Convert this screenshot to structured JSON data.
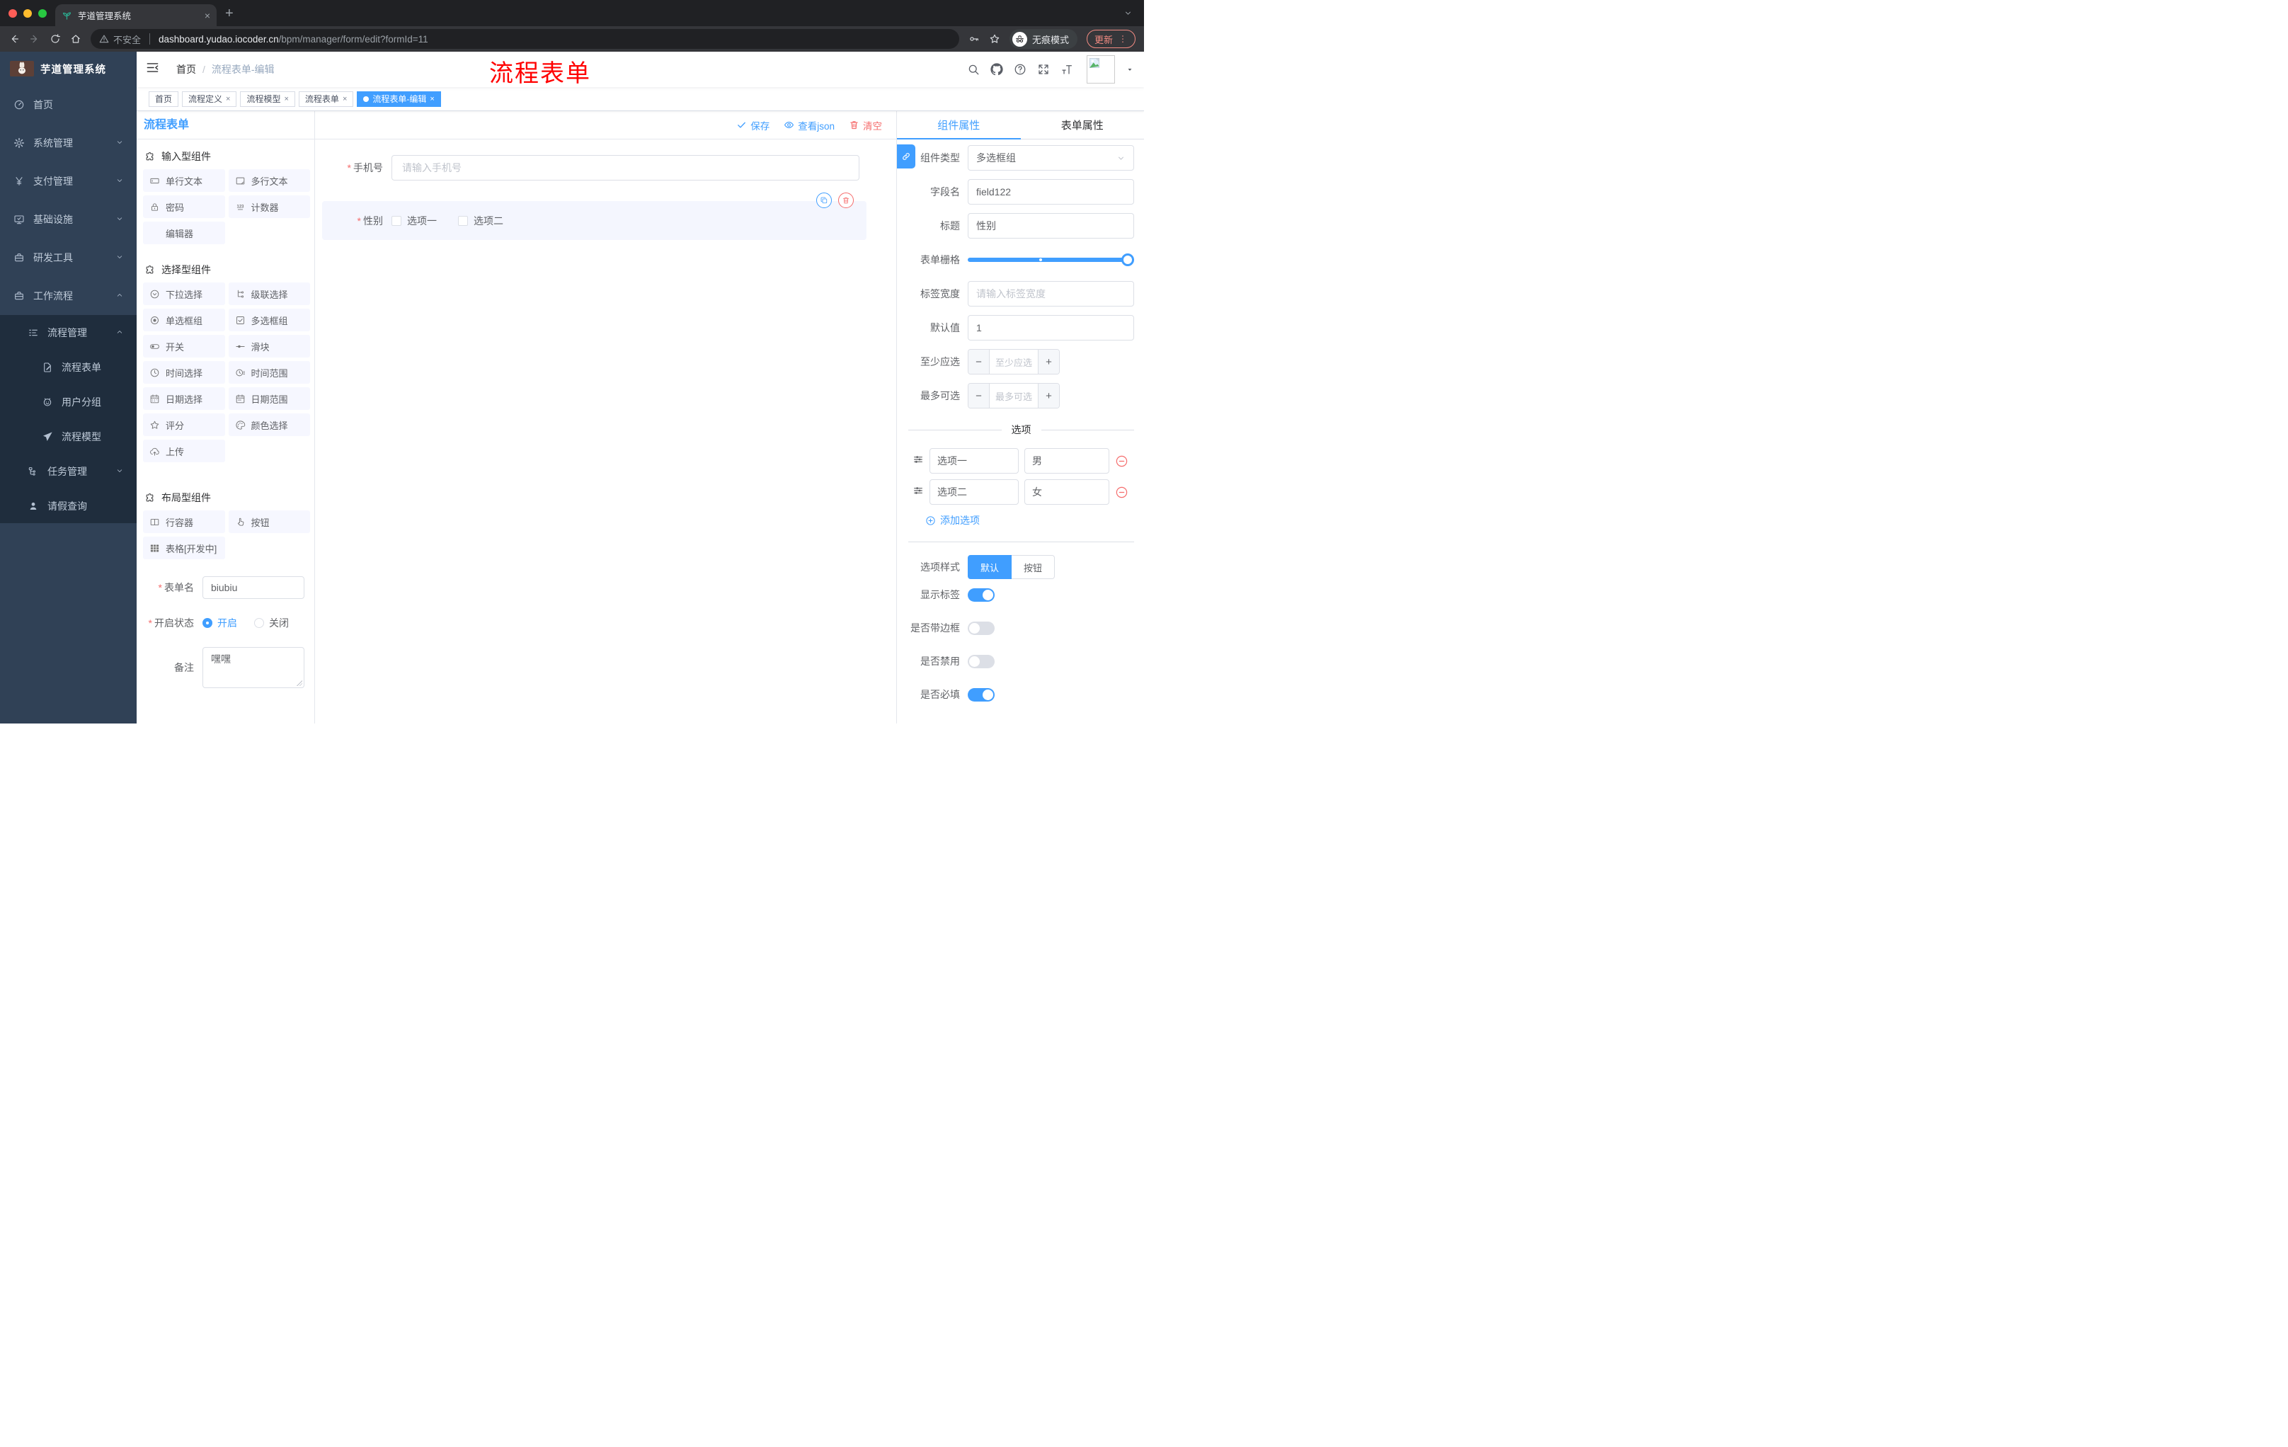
{
  "required_mark": "*",
  "browser": {
    "tab_title": "芋道管理系统",
    "new_tab": "+",
    "tab_close": "×",
    "security_chip": "不安全",
    "url_host": "dashboard.yudao.iocoder.cn",
    "url_path": "/bpm/manager/form/edit?formId=11",
    "incognito_label": "无痕模式",
    "update_button": "更新"
  },
  "sidebar": {
    "logo_title": "芋道管理系统",
    "items": [
      {
        "label": "首页",
        "icon": "dashboard",
        "level": 1
      },
      {
        "label": "系统管理",
        "icon": "gear",
        "level": 1,
        "arrow": "down"
      },
      {
        "label": "支付管理",
        "icon": "yen",
        "level": 1,
        "arrow": "down"
      },
      {
        "label": "基础设施",
        "icon": "monitor",
        "level": 1,
        "arrow": "down"
      },
      {
        "label": "研发工具",
        "icon": "briefcase",
        "level": 1,
        "arrow": "down"
      },
      {
        "label": "工作流程",
        "icon": "briefcase",
        "level": 1,
        "arrow": "up"
      },
      {
        "label": "流程管理",
        "icon": "list-tree",
        "level": 2,
        "arrow": "up"
      },
      {
        "label": "流程表单",
        "icon": "doc-edit",
        "level": 3
      },
      {
        "label": "用户分组",
        "icon": "robot",
        "level": 3
      },
      {
        "label": "流程模型",
        "icon": "paper-plane",
        "level": 3
      },
      {
        "label": "任务管理",
        "icon": "org",
        "level": 2,
        "arrow": "down"
      },
      {
        "label": "请假查询",
        "icon": "person",
        "level": 2
      }
    ]
  },
  "navbar": {
    "breadcrumb_home": "首页",
    "breadcrumb_sep": "/",
    "breadcrumb_current": "流程表单-编辑",
    "annotation": "流程表单"
  },
  "tags": [
    {
      "label": "首页",
      "closable": false,
      "active": false
    },
    {
      "label": "流程定义",
      "closable": true,
      "active": false
    },
    {
      "label": "流程模型",
      "closable": true,
      "active": false
    },
    {
      "label": "流程表单",
      "closable": true,
      "active": false
    },
    {
      "label": "流程表单-编辑",
      "closable": true,
      "active": true
    }
  ],
  "palette": {
    "title": "流程表单",
    "sections": [
      {
        "title": "输入型组件",
        "items": [
          {
            "label": "单行文本",
            "icon": "input"
          },
          {
            "label": "多行文本",
            "icon": "textarea"
          },
          {
            "label": "密码",
            "icon": "lock"
          },
          {
            "label": "计数器",
            "icon": "counter"
          },
          {
            "label": "编辑器",
            "icon": null
          }
        ]
      },
      {
        "title": "选择型组件",
        "items": [
          {
            "label": "下拉选择",
            "icon": "select"
          },
          {
            "label": "级联选择",
            "icon": "cascade"
          },
          {
            "label": "单选框组",
            "icon": "radio"
          },
          {
            "label": "多选框组",
            "icon": "checkbox"
          },
          {
            "label": "开关",
            "icon": "switch"
          },
          {
            "label": "滑块",
            "icon": "slider"
          },
          {
            "label": "时间选择",
            "icon": "clock"
          },
          {
            "label": "时间范围",
            "icon": "time-range"
          },
          {
            "label": "日期选择",
            "icon": "calendar"
          },
          {
            "label": "日期范围",
            "icon": "calendar-range"
          },
          {
            "label": "评分",
            "icon": "star"
          },
          {
            "label": "颜色选择",
            "icon": "palette"
          },
          {
            "label": "上传",
            "icon": "upload"
          }
        ]
      },
      {
        "title": "布局型组件",
        "items": [
          {
            "label": "行容器",
            "icon": "columns"
          },
          {
            "label": "按钮",
            "icon": "pointer"
          },
          {
            "label": "表格[开发中]",
            "icon": "table"
          }
        ]
      }
    ],
    "form": {
      "name_label": "表单名",
      "name_value": "biubiu",
      "status_label": "开启状态",
      "status_options": [
        {
          "label": "开启",
          "selected": true
        },
        {
          "label": "关闭",
          "selected": false
        }
      ],
      "remark_label": "备注",
      "remark_value": "嘿嘿"
    }
  },
  "canvas": {
    "actions": [
      {
        "label": "保存",
        "icon": "check",
        "color": "#409eff"
      },
      {
        "label": "查看json",
        "icon": "eye",
        "color": "#409eff"
      },
      {
        "label": "清空",
        "icon": "trash",
        "color": "#f56c6c"
      }
    ],
    "phone_field": {
      "label": "手机号",
      "placeholder": "请输入手机号"
    },
    "gender_field": {
      "label": "性别",
      "options": [
        "选项一",
        "选项二"
      ]
    }
  },
  "panel": {
    "tabs": [
      {
        "label": "组件属性",
        "active": true
      },
      {
        "label": "表单属性",
        "active": false
      }
    ],
    "rows": {
      "type_label": "组件类型",
      "type_value": "多选框组",
      "field_label": "字段名",
      "field_value": "field122",
      "title_label": "标题",
      "title_value": "性别",
      "grid_label": "表单栅格",
      "labelwidth_label": "标签宽度",
      "labelwidth_placeholder": "请输入标签宽度",
      "default_label": "默认值",
      "default_value": "1",
      "min_label": "至少应选",
      "min_placeholder": "至少应选",
      "max_label": "最多可选",
      "max_placeholder": "最多可选",
      "stepper_minus": "−",
      "stepper_plus": "+"
    },
    "options_divider": "选项",
    "options": [
      {
        "name": "选项一",
        "value": "男"
      },
      {
        "name": "选项二",
        "value": "女"
      }
    ],
    "add_option": "添加选项",
    "style_label": "选项样式",
    "style_options": [
      {
        "label": "默认",
        "active": true
      },
      {
        "label": "按钮",
        "active": false
      }
    ],
    "switches": [
      {
        "label": "显示标签",
        "on": true
      },
      {
        "label": "是否带边框",
        "on": false
      },
      {
        "label": "是否禁用",
        "on": false
      },
      {
        "label": "是否必填",
        "on": true
      }
    ]
  },
  "colors": {
    "accent": "#409eff",
    "danger": "#f56c6c",
    "annotation": "#ff0000",
    "sidebar_bg": "#304156",
    "submenu_bg": "#1f2d3d"
  }
}
